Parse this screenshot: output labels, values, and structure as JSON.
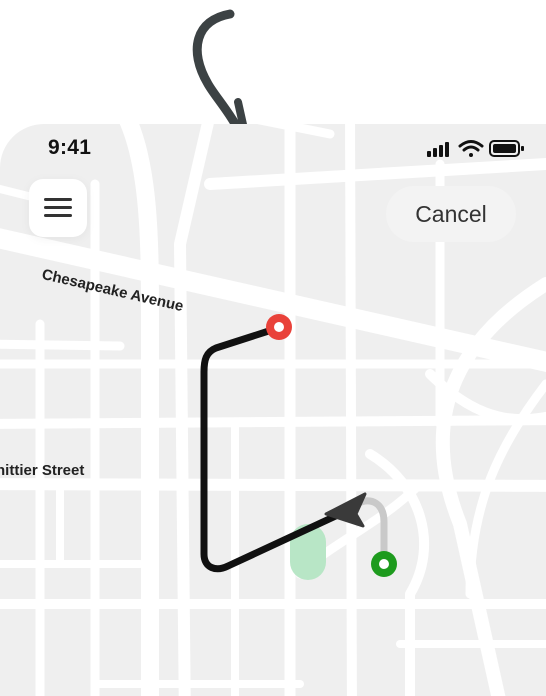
{
  "status_bar": {
    "time": "9:41"
  },
  "header": {
    "cancel_label": "Cancel"
  },
  "map": {
    "streets": {
      "chesapeake": "Chesapeake Avenue",
      "whittier": "hittier Street"
    },
    "markers": {
      "destination_color": "#e9423a",
      "origin_color": "#1e9b1e"
    },
    "route_color": "#111111",
    "highlight_color": "#b8e6c6"
  },
  "icons": [
    "annotation-arrow-icon",
    "signal-icon",
    "wifi-icon",
    "battery-icon",
    "hamburger-menu-icon",
    "navigation-arrow-icon"
  ]
}
